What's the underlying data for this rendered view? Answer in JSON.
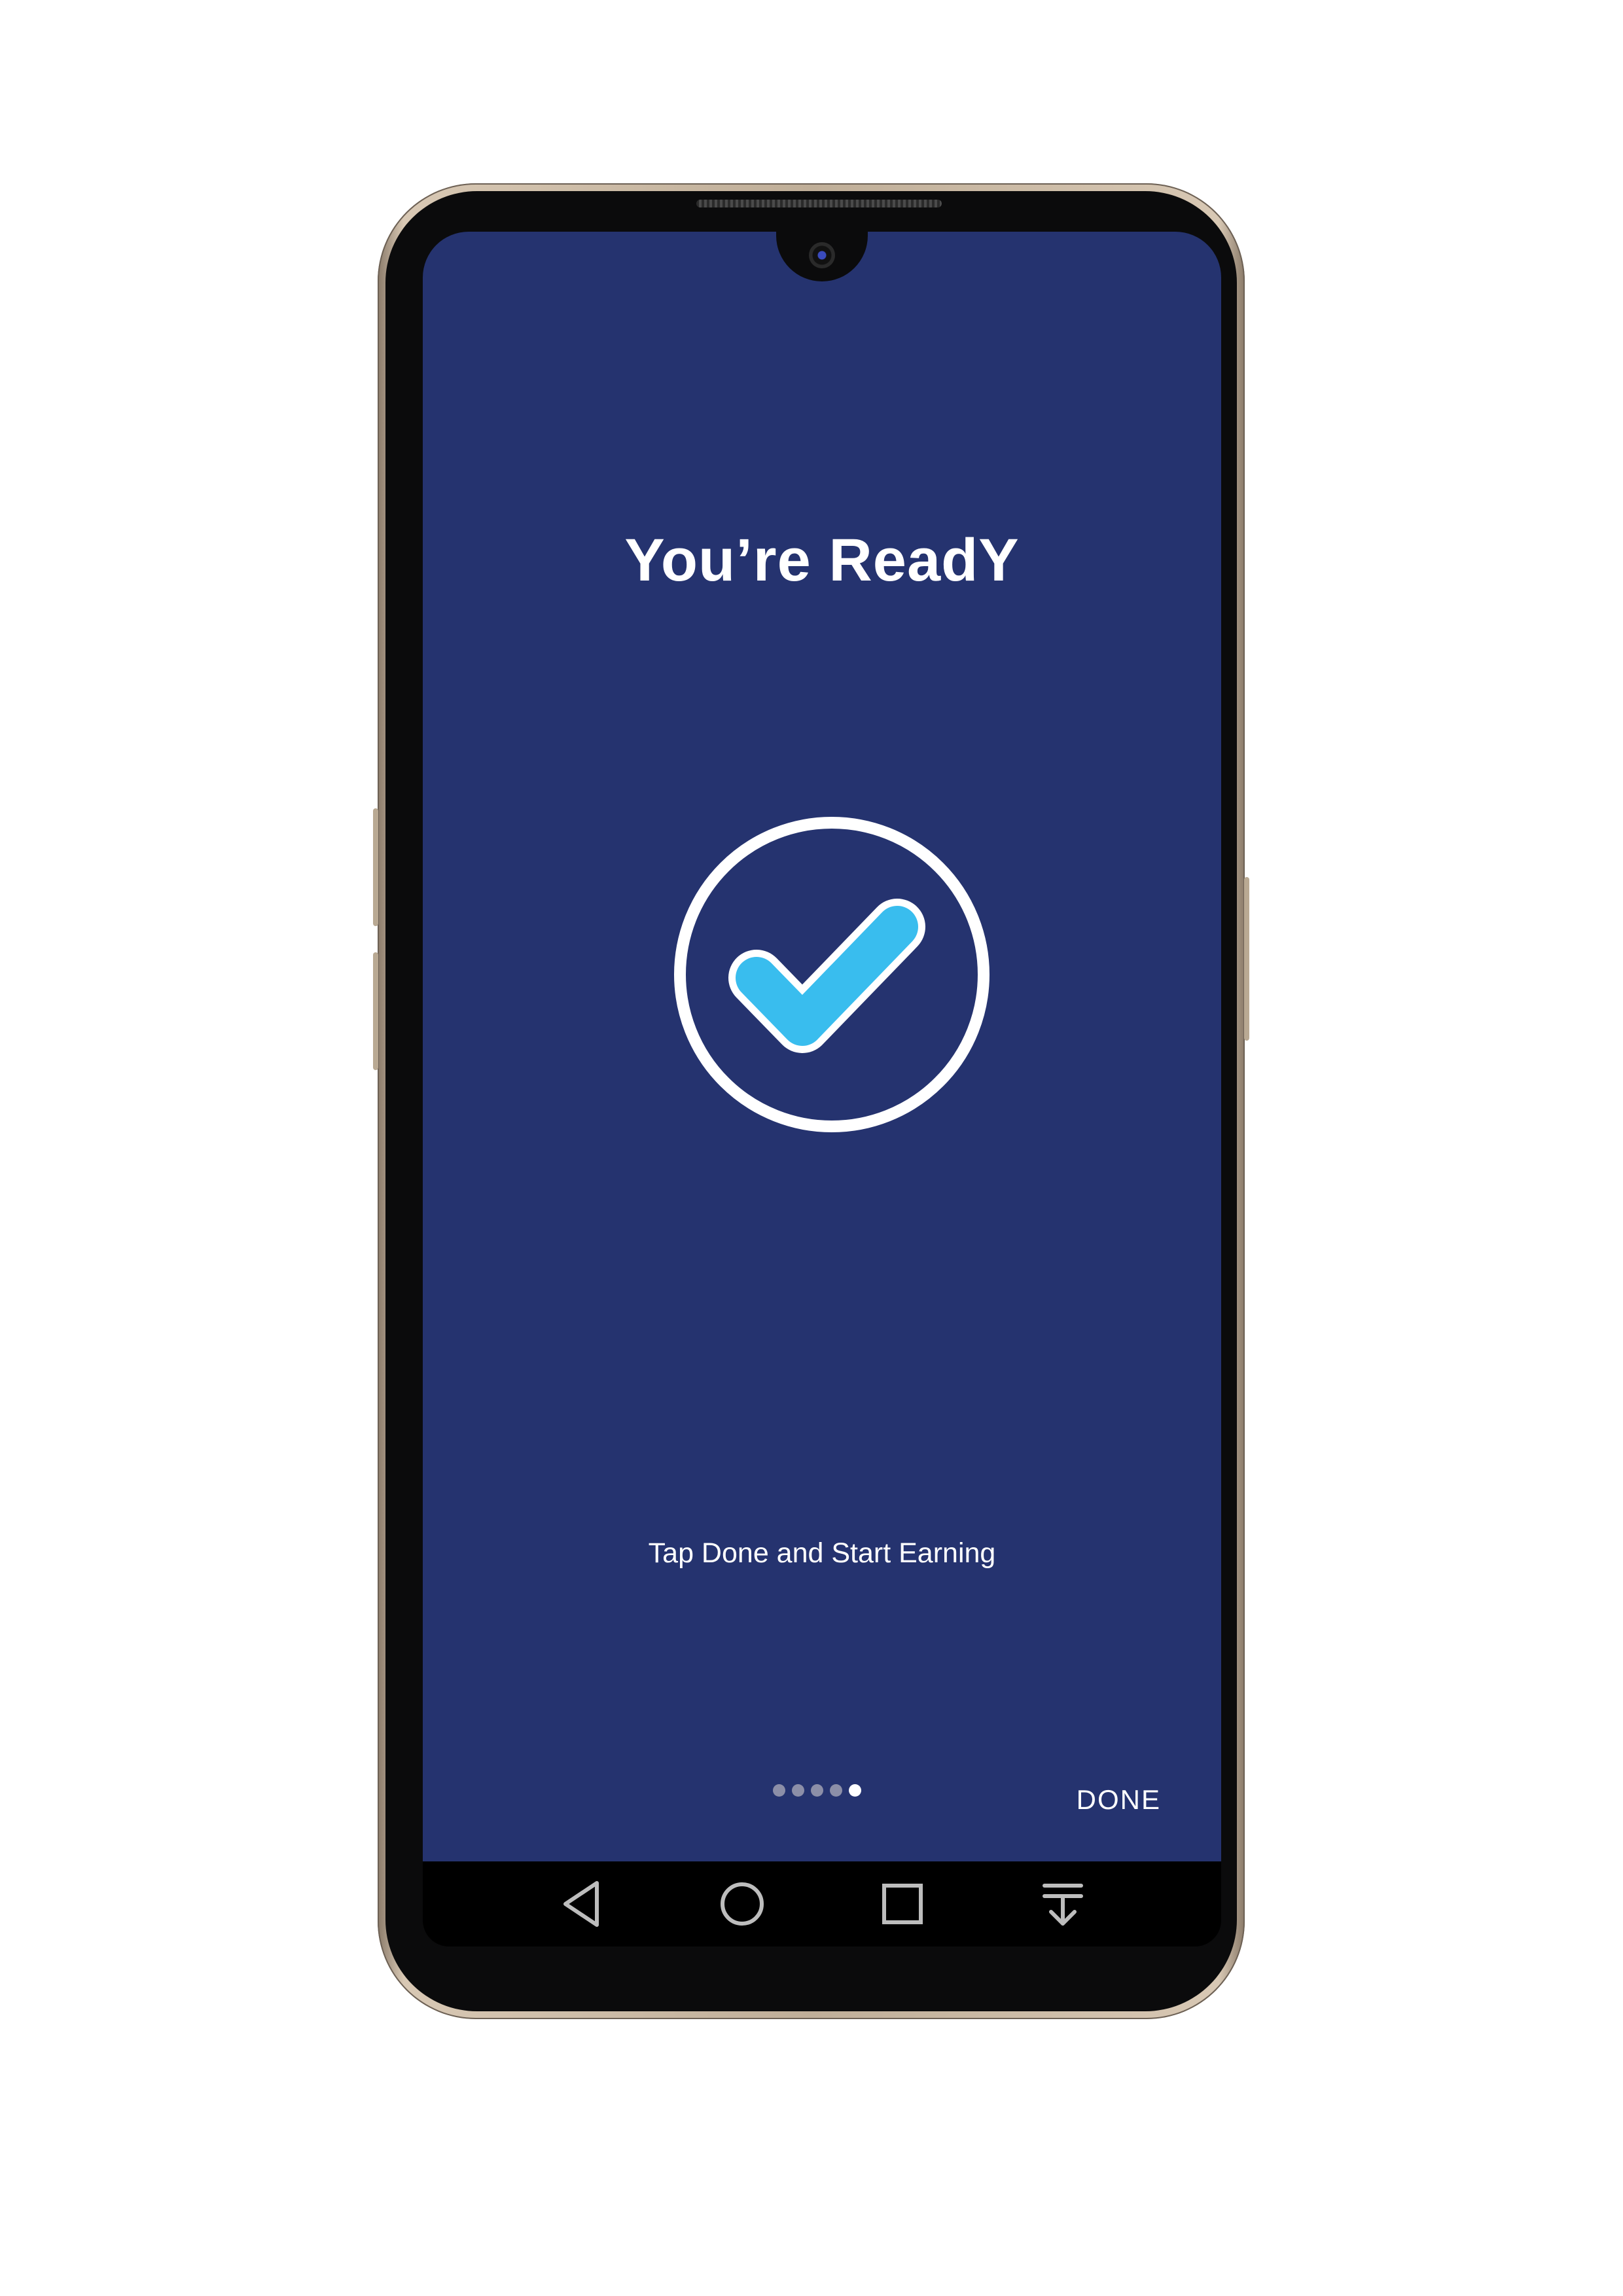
{
  "screen": {
    "title": "You’re ReadY",
    "subtitle": "Tap Done and Start Earning",
    "done_label": "DONE",
    "page_indicator": {
      "total": 5,
      "current": 5
    },
    "icon": "checkmark-circle-icon"
  },
  "navbar": {
    "buttons": [
      "back-icon",
      "home-icon",
      "recents-icon",
      "notifications-pulldown-icon"
    ]
  },
  "colors": {
    "screen_background": "#25336f",
    "check_fill": "#39bdee",
    "text": "#ffffff"
  }
}
